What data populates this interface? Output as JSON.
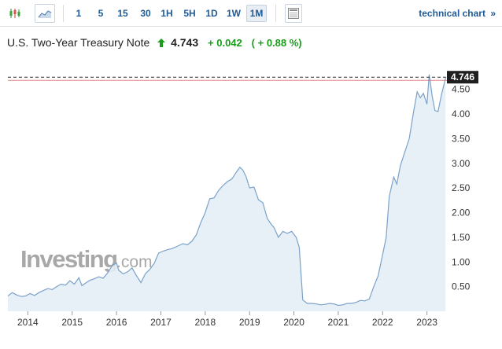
{
  "toolbar": {
    "timeframes": [
      "1",
      "5",
      "15",
      "30",
      "1H",
      "5H",
      "1D",
      "1W",
      "1M"
    ],
    "active_timeframe": "1M",
    "technical_link": "technical chart",
    "technical_arrow": "»",
    "icons": [
      "candlestick-icon",
      "area-chart-icon",
      "table-icon"
    ]
  },
  "quote": {
    "name": "U.S. Two-Year Treasury Note",
    "price": "4.743",
    "change": "+ 0.042",
    "change_pct": "( + 0.88 %)"
  },
  "watermark": {
    "brand": "Investing",
    "suffix": ".com"
  },
  "colors": {
    "line": "#7ba2c9",
    "fill": "#e4edf6",
    "positive": "#1a9d1a",
    "link": "#1f5a96",
    "current_badge": "#1f1f1f",
    "red_line": "#d9534f"
  },
  "chart_data": {
    "type": "area",
    "title": "U.S. Two-Year Treasury Note",
    "xlabel": "",
    "ylabel": "",
    "x_ticks": [
      "2014",
      "2015",
      "2016",
      "2017",
      "2018",
      "2019",
      "2020",
      "2021",
      "2022",
      "2023"
    ],
    "y_ticks": [
      "0.50",
      "1.00",
      "1.50",
      "2.00",
      "2.50",
      "3.00",
      "3.50",
      "4.00",
      "4.50"
    ],
    "ylim": [
      0.0,
      5.1
    ],
    "xlim": [
      2013.55,
      2023.45
    ],
    "current_value": "4.746",
    "grid": false,
    "series": [
      {
        "values": [
          [
            2013.55,
            0.31
          ],
          [
            2013.65,
            0.38
          ],
          [
            2013.75,
            0.33
          ],
          [
            2013.85,
            0.3
          ],
          [
            2013.95,
            0.31
          ],
          [
            2014.05,
            0.36
          ],
          [
            2014.15,
            0.32
          ],
          [
            2014.25,
            0.38
          ],
          [
            2014.35,
            0.42
          ],
          [
            2014.45,
            0.46
          ],
          [
            2014.55,
            0.44
          ],
          [
            2014.65,
            0.5
          ],
          [
            2014.75,
            0.55
          ],
          [
            2014.85,
            0.53
          ],
          [
            2014.95,
            0.62
          ],
          [
            2015.05,
            0.55
          ],
          [
            2015.15,
            0.68
          ],
          [
            2015.22,
            0.52
          ],
          [
            2015.3,
            0.57
          ],
          [
            2015.4,
            0.63
          ],
          [
            2015.5,
            0.66
          ],
          [
            2015.6,
            0.7
          ],
          [
            2015.7,
            0.67
          ],
          [
            2015.8,
            0.78
          ],
          [
            2015.9,
            0.92
          ],
          [
            2016.0,
            0.98
          ],
          [
            2016.05,
            0.83
          ],
          [
            2016.15,
            0.76
          ],
          [
            2016.25,
            0.8
          ],
          [
            2016.35,
            0.88
          ],
          [
            2016.45,
            0.72
          ],
          [
            2016.55,
            0.58
          ],
          [
            2016.65,
            0.76
          ],
          [
            2016.75,
            0.85
          ],
          [
            2016.85,
            0.97
          ],
          [
            2016.95,
            1.18
          ],
          [
            2017.05,
            1.22
          ],
          [
            2017.15,
            1.25
          ],
          [
            2017.25,
            1.27
          ],
          [
            2017.4,
            1.33
          ],
          [
            2017.5,
            1.37
          ],
          [
            2017.6,
            1.35
          ],
          [
            2017.7,
            1.42
          ],
          [
            2017.8,
            1.55
          ],
          [
            2017.9,
            1.8
          ],
          [
            2018.0,
            2.0
          ],
          [
            2018.1,
            2.28
          ],
          [
            2018.2,
            2.3
          ],
          [
            2018.3,
            2.45
          ],
          [
            2018.4,
            2.55
          ],
          [
            2018.5,
            2.63
          ],
          [
            2018.6,
            2.68
          ],
          [
            2018.7,
            2.82
          ],
          [
            2018.78,
            2.92
          ],
          [
            2018.85,
            2.86
          ],
          [
            2018.92,
            2.73
          ],
          [
            2019.0,
            2.5
          ],
          [
            2019.1,
            2.52
          ],
          [
            2019.2,
            2.26
          ],
          [
            2019.3,
            2.2
          ],
          [
            2019.4,
            1.88
          ],
          [
            2019.5,
            1.75
          ],
          [
            2019.55,
            1.7
          ],
          [
            2019.65,
            1.5
          ],
          [
            2019.75,
            1.62
          ],
          [
            2019.85,
            1.58
          ],
          [
            2019.95,
            1.62
          ],
          [
            2020.05,
            1.5
          ],
          [
            2020.12,
            1.3
          ],
          [
            2020.2,
            0.23
          ],
          [
            2020.3,
            0.16
          ],
          [
            2020.4,
            0.16
          ],
          [
            2020.5,
            0.15
          ],
          [
            2020.6,
            0.13
          ],
          [
            2020.7,
            0.14
          ],
          [
            2020.8,
            0.16
          ],
          [
            2020.9,
            0.15
          ],
          [
            2021.0,
            0.12
          ],
          [
            2021.1,
            0.13
          ],
          [
            2021.2,
            0.16
          ],
          [
            2021.3,
            0.16
          ],
          [
            2021.4,
            0.18
          ],
          [
            2021.5,
            0.22
          ],
          [
            2021.6,
            0.21
          ],
          [
            2021.7,
            0.25
          ],
          [
            2021.8,
            0.5
          ],
          [
            2021.9,
            0.72
          ],
          [
            2022.0,
            1.15
          ],
          [
            2022.08,
            1.5
          ],
          [
            2022.15,
            2.33
          ],
          [
            2022.25,
            2.72
          ],
          [
            2022.32,
            2.58
          ],
          [
            2022.4,
            2.95
          ],
          [
            2022.5,
            3.23
          ],
          [
            2022.6,
            3.5
          ],
          [
            2022.7,
            4.05
          ],
          [
            2022.78,
            4.45
          ],
          [
            2022.85,
            4.33
          ],
          [
            2022.92,
            4.42
          ],
          [
            2023.0,
            4.2
          ],
          [
            2023.05,
            4.8
          ],
          [
            2023.12,
            4.35
          ],
          [
            2023.18,
            4.07
          ],
          [
            2023.25,
            4.05
          ],
          [
            2023.33,
            4.4
          ],
          [
            2023.42,
            4.73
          ]
        ]
      }
    ]
  }
}
